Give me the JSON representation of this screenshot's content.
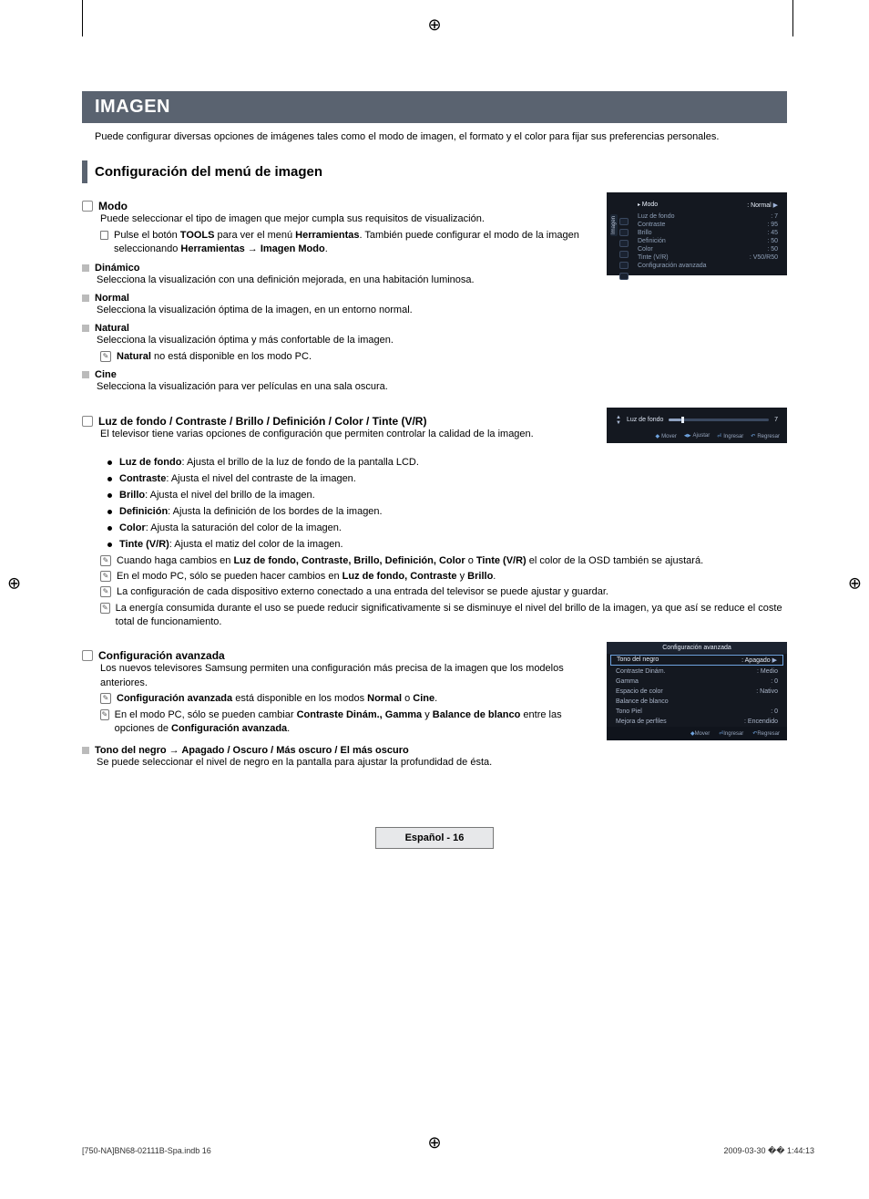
{
  "page": {
    "title": "IMAGEN",
    "intro": "Puede configurar diversas opciones de imágenes tales como el modo de imagen, el formato y el color para fijar sus preferencias personales.",
    "section_title": "Configuración del menú de imagen",
    "footer_label": "Español - 16",
    "doc_footer_left": "[750-NA]BN68-02111B-Spa.indb   16",
    "doc_footer_right": "2009-03-30   �� 1:44:13"
  },
  "modo": {
    "heading": "Modo",
    "desc": "Puede seleccionar el tipo de imagen que mejor cumpla sus requisitos de visualización.",
    "tool_pre": "Pulse el botón ",
    "tool_bold1": "TOOLS",
    "tool_mid1": " para ver el menú ",
    "tool_bold2": "Herramientas",
    "tool_mid2": ". También puede configurar el modo de la imagen seleccionando ",
    "tool_bold3": "Herramientas → Imagen Modo",
    "tool_end": ".",
    "items": [
      {
        "name": "Dinámico",
        "desc": "Selecciona la visualización con una definición mejorada, en una habitación luminosa."
      },
      {
        "name": "Normal",
        "desc": "Selecciona la visualización óptima de la imagen, en un entorno normal."
      },
      {
        "name": "Natural",
        "desc": "Selecciona la visualización óptima y más confortable de la imagen.",
        "note_bold": "Natural",
        "note_rest": " no está disponible en los modo PC."
      },
      {
        "name": "Cine",
        "desc": "Selecciona la visualización para ver películas en una sala oscura."
      }
    ]
  },
  "ajustes": {
    "heading": "Luz de fondo / Contraste / Brillo / Definición / Color / Tinte (V/R)",
    "desc": "El televisor tiene varias opciones de configuración que permiten controlar la calidad de la imagen.",
    "bullets": [
      {
        "b": "Luz de fondo",
        "t": ": Ajusta el brillo de la luz de fondo de la pantalla LCD."
      },
      {
        "b": "Contraste",
        "t": ": Ajusta el nivel del contraste de la imagen."
      },
      {
        "b": "Brillo",
        "t": ": Ajusta el nivel del brillo de la imagen."
      },
      {
        "b": "Definición",
        "t": ": Ajusta la definición de los bordes de la imagen."
      },
      {
        "b": "Color",
        "t": ": Ajusta la saturación del color de la imagen."
      },
      {
        "b": "Tinte (V/R)",
        "t": ": Ajusta el matiz del color de la imagen."
      }
    ],
    "notes": [
      {
        "pre": "Cuando haga cambios en ",
        "b1": "Luz de fondo, Contraste, Brillo, Definición, Color",
        "mid": " o ",
        "b2": "Tinte (V/R)",
        "post": " el color de la OSD también se ajustará."
      },
      {
        "pre": "En el modo PC, sólo se pueden hacer cambios en ",
        "b1": "Luz de fondo, Contraste",
        "mid": " y ",
        "b2": "Brillo",
        "post": "."
      },
      {
        "plain": "La configuración de cada dispositivo externo conectado a una entrada del televisor se puede ajustar y guardar."
      },
      {
        "plain": "La energía consumida durante el uso se puede reducir significativamente si se disminuye el nivel del brillo de la imagen, ya que así se reduce el coste total de funcionamiento."
      }
    ]
  },
  "avanzada": {
    "heading": "Configuración avanzada",
    "desc": "Los nuevos televisores Samsung permiten una configuración más precisa de la imagen que los modelos anteriores.",
    "notes": [
      {
        "b1": "Configuración avanzada",
        "mid": " está disponible en los modos ",
        "b2": "Normal",
        "mid2": " o ",
        "b3": "Cine",
        "post": "."
      },
      {
        "pre": "En el modo PC, sólo se pueden cambiar ",
        "b1": "Contraste Dinám., Gamma",
        "mid": " y ",
        "b2": "Balance de blanco",
        "post_pre": " entre las opciones de ",
        "b3": "Configuración avanzada",
        "post": "."
      }
    ],
    "sub": {
      "name": "Tono del negro → Apagado / Oscuro / Más oscuro / El más oscuro",
      "desc": "Se puede seleccionar el nivel de negro en la pantalla para ajustar la profundidad de ésta."
    }
  },
  "osd1": {
    "side_label": "Imagen",
    "head_label": "Modo",
    "head_value": ": Normal",
    "rows": [
      {
        "k": "Luz de fondo",
        "v": ": 7"
      },
      {
        "k": "Contraste",
        "v": ": 95"
      },
      {
        "k": "Brillo",
        "v": ": 45"
      },
      {
        "k": "Definición",
        "v": ": 50"
      },
      {
        "k": "Color",
        "v": ": 50"
      },
      {
        "k": "Tinte (V/R)",
        "v": ": V50/R50"
      },
      {
        "k": "Configuración avanzada",
        "v": ""
      }
    ]
  },
  "osd2": {
    "label": "Luz de fondo",
    "value": "7",
    "help": {
      "move": "Mover",
      "adjust": "Ajustar",
      "enter": "Ingresar",
      "ret": "Regresar"
    }
  },
  "osd3": {
    "title": "Configuración avanzada",
    "rows": [
      {
        "k": "Tono del negro",
        "v": ": Apagado",
        "sel": true,
        "arrow": true
      },
      {
        "k": "Contraste Dinám.",
        "v": ": Medio"
      },
      {
        "k": "Gamma",
        "v": ": 0"
      },
      {
        "k": "Espacio de color",
        "v": ": Nativo"
      },
      {
        "k": "Balance de blanco",
        "v": ""
      },
      {
        "k": "Tono Piel",
        "v": ": 0"
      },
      {
        "k": "Mejora de perfiles",
        "v": ": Encendido"
      }
    ],
    "help": {
      "move": "Mover",
      "enter": "Ingresar",
      "ret": "Regresar"
    }
  },
  "chart_data": {
    "type": "table",
    "title": "Imagen OSD values",
    "rows": [
      {
        "setting": "Modo",
        "value": "Normal"
      },
      {
        "setting": "Luz de fondo",
        "value": 7
      },
      {
        "setting": "Contraste",
        "value": 95
      },
      {
        "setting": "Brillo",
        "value": 45
      },
      {
        "setting": "Definición",
        "value": 50
      },
      {
        "setting": "Color",
        "value": 50
      },
      {
        "setting": "Tinte (V/R)",
        "value": "V50/R50"
      }
    ]
  }
}
